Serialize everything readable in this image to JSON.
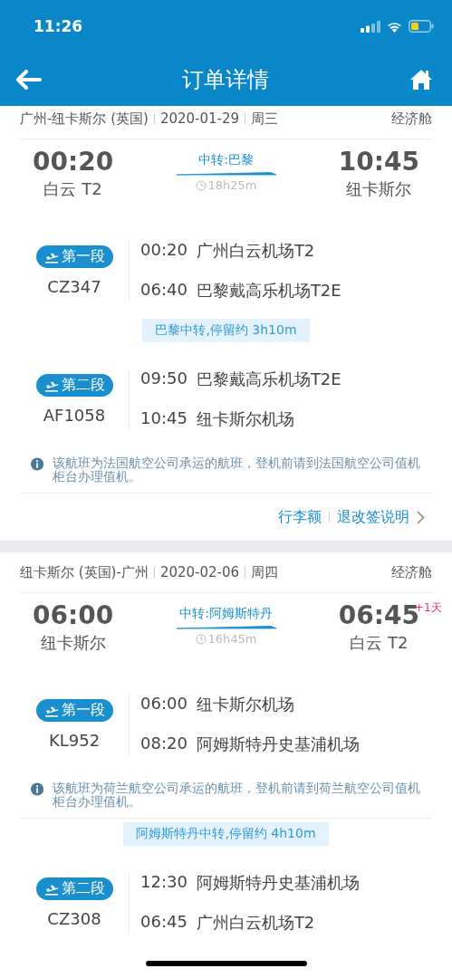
{
  "status_bar": {
    "time": "11:26"
  },
  "nav": {
    "title": "订单详情"
  },
  "trips": [
    {
      "route": "广州-纽卡斯尔 (英国)",
      "date": "2020-01-29",
      "weekday": "周三",
      "cabin": "经济舱",
      "summary": {
        "dep_time": "00:20",
        "dep_place": "白云 T2",
        "transfer": "中转:巴黎",
        "duration": "18h25m",
        "arr_time": "10:45",
        "arr_place": "纽卡斯尔"
      },
      "blocks": [
        {
          "kind": "segment",
          "badge": "第一段",
          "flight": "CZ347",
          "stops": [
            {
              "time": "00:20",
              "airport": "广州白云机场T2"
            },
            {
              "time": "06:40",
              "airport": "巴黎戴高乐机场T2E"
            }
          ]
        },
        {
          "kind": "layover",
          "text": "巴黎中转,停留约 3h10m"
        },
        {
          "kind": "segment",
          "badge": "第二段",
          "flight": "AF1058",
          "stops": [
            {
              "time": "09:50",
              "airport": "巴黎戴高乐机场T2E"
            },
            {
              "time": "10:45",
              "airport": "纽卡斯尔机场"
            }
          ]
        },
        {
          "kind": "notice",
          "text": "该航班为法国航空公司承运的航班，登机前请到法国航空公司值机柜台办理值机。"
        },
        {
          "kind": "links",
          "links": [
            "行李额",
            "退改签说明"
          ]
        }
      ]
    },
    {
      "route": "纽卡斯尔 (英国)-广州",
      "date": "2020-02-06",
      "weekday": "周四",
      "cabin": "经济舱",
      "summary": {
        "dep_time": "06:00",
        "dep_place": "纽卡斯尔",
        "transfer": "中转:阿姆斯特丹",
        "duration": "16h45m",
        "arr_time": "06:45",
        "day_offset": "+1天",
        "arr_place": "白云 T2"
      },
      "blocks": [
        {
          "kind": "segment",
          "badge": "第一段",
          "flight": "KL952",
          "stops": [
            {
              "time": "06:00",
              "airport": "纽卡斯尔机场"
            },
            {
              "time": "08:20",
              "airport": "阿姆斯特丹史基浦机场"
            }
          ]
        },
        {
          "kind": "notice",
          "text": "该航班为荷兰航空公司承运的航班，登机前请到荷兰航空公司值机柜台办理值机。"
        },
        {
          "kind": "layover",
          "text": "阿姆斯特丹中转,停留约 4h10m"
        },
        {
          "kind": "segment",
          "badge": "第二段",
          "flight": "CZ308",
          "stops": [
            {
              "time": "12:30",
              "airport": "阿姆斯特丹史基浦机场"
            },
            {
              "time": "06:45",
              "airport": "广州白云机场T2"
            }
          ]
        }
      ]
    }
  ]
}
